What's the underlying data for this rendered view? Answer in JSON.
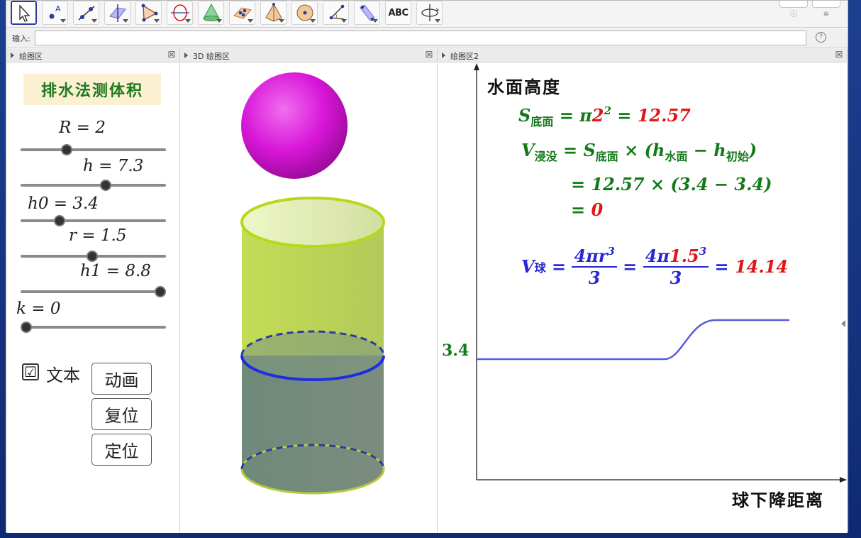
{
  "toolbar": {
    "tools": [
      {
        "name": "move-tool",
        "icon": "cursor-arrow-icon"
      },
      {
        "name": "point-tool",
        "icon": "point-A-icon"
      },
      {
        "name": "line-tool",
        "icon": "line-icon"
      },
      {
        "name": "perpendicular-plane-tool",
        "icon": "plane-line-icon"
      },
      {
        "name": "polygon-tool",
        "icon": "triangle-icon"
      },
      {
        "name": "circle-tool",
        "icon": "circle-axis-icon"
      },
      {
        "name": "cone-tool",
        "icon": "cone-icon"
      },
      {
        "name": "plane-points-tool",
        "icon": "plane-points-icon"
      },
      {
        "name": "pyramid-tool",
        "icon": "pyramid-icon"
      },
      {
        "name": "sphere-tool",
        "icon": "sphere-icon"
      },
      {
        "name": "angle-tool",
        "icon": "angle-icon"
      },
      {
        "name": "reflect-tool",
        "icon": "reflect-icon"
      },
      {
        "name": "text-tool",
        "label": "ABC"
      },
      {
        "name": "rotate-view-tool",
        "icon": "rotate-view-icon"
      }
    ]
  },
  "input_bar": {
    "label": "输入:",
    "value": "",
    "help": "?"
  },
  "panels": {
    "algebra_graphics": {
      "title": "绘图区"
    },
    "view3d": {
      "title": "3D 绘图区"
    },
    "graphics2": {
      "title": "绘图区2"
    }
  },
  "left": {
    "title": "排水法测体积",
    "sliders": [
      {
        "label": "R = 2",
        "fraction": 0.3
      },
      {
        "label": "h = 7.3",
        "fraction": 0.59
      },
      {
        "label": "h0 = 3.4",
        "fraction": 0.25
      },
      {
        "label": "r = 1.5",
        "fraction": 0.49
      },
      {
        "label": "h1 = 8.8",
        "fraction": 1.0
      },
      {
        "label": "k = 0",
        "fraction": 0.0
      }
    ],
    "checkbox": {
      "checked": "☑",
      "label": "文本"
    },
    "buttons": {
      "animate": "动画",
      "reset": "复位",
      "locate": "定位"
    }
  },
  "graph2": {
    "y_axis_label": "水面高度",
    "x_axis_label": "球下降距离",
    "y_tick": "3.4",
    "f1": {
      "s": "S",
      "s_sub": "底面",
      "eq": " = π",
      "val": "2",
      "exp": "2",
      "eq2": " = ",
      "res": "12.57"
    },
    "f2": {
      "v": "V",
      "v_sub": "浸没",
      "mid": " = S",
      "s_sub": "底面",
      "times": " × (h",
      "h1_sub": "水面",
      "minus": " − h",
      "h2_sub": "初始",
      "close": ")"
    },
    "f3": {
      "text": "= 12.57 × (3.4 − 3.4)"
    },
    "f4": {
      "eq": "= ",
      "res": "0"
    },
    "f5": {
      "v": "V",
      "v_sub": "球",
      "eq": " = ",
      "num1": "4πr",
      "exp1": "3",
      "den1": "3",
      "eq2": " = ",
      "num2a": "4π",
      "num2b": "1.5",
      "exp2": "3",
      "den2": "3",
      "eq3": " = ",
      "res": "14.14"
    }
  },
  "colors": {
    "accent": "#2a3d9c",
    "green": "#137a1a",
    "red": "#e01616",
    "blue": "#2727d6",
    "sphere": "#d816d8",
    "cylinder": "#c8dc60",
    "water": "#6e7f83",
    "curve": "#5a5adf"
  }
}
